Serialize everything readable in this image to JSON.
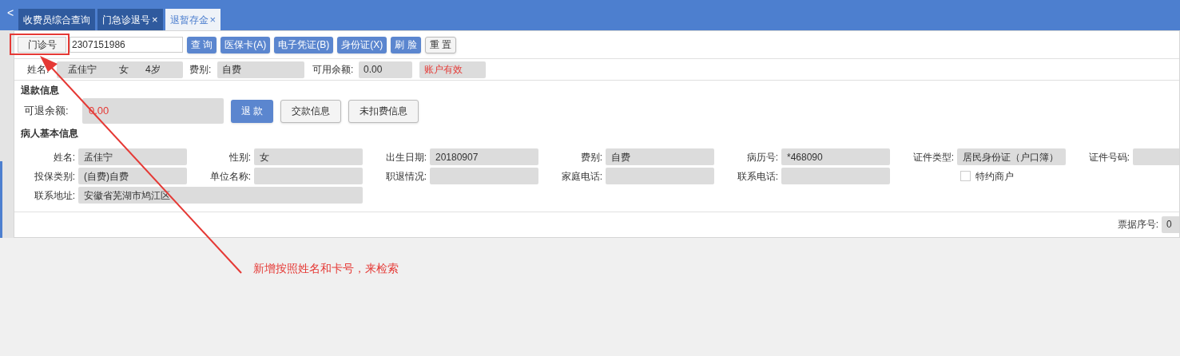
{
  "nav_back": "<",
  "tabs": [
    {
      "label": "收费员综合查询",
      "selected": false,
      "closable": false
    },
    {
      "label": "门急诊退号",
      "selected": false,
      "closable": true
    },
    {
      "label": "退暂存金",
      "selected": true,
      "closable": true
    }
  ],
  "close_glyph": "×",
  "search": {
    "type_button": "门诊号",
    "value": "2307151986",
    "buttons": [
      "查 询",
      "医保卡(A)",
      "电子凭证(B)",
      "身份证(X)",
      "刷 脸"
    ],
    "reset": "重 置"
  },
  "summary": {
    "name_label": "姓名:",
    "name": "孟佳宁",
    "sex": "女",
    "age": "4岁",
    "fee_label": "费别:",
    "fee": "自费",
    "balance_label": "可用余额:",
    "balance": "0.00",
    "account_status": "账户有效"
  },
  "refund": {
    "title": "退款信息",
    "label": "可退余额:",
    "amount": "0.00",
    "buttons": [
      {
        "label": "退 款",
        "kind": "primary"
      },
      {
        "label": "交款信息",
        "kind": "plain"
      },
      {
        "label": "未扣费信息",
        "kind": "plain"
      }
    ]
  },
  "patient": {
    "title": "病人基本信息",
    "fields": [
      {
        "label": "姓名:",
        "value": "孟佳宁",
        "kind": "field"
      },
      {
        "label": "性别:",
        "value": "女",
        "kind": "field"
      },
      {
        "label": "出生日期:",
        "value": "20180907",
        "kind": "field"
      },
      {
        "label": "费别:",
        "value": "自费",
        "kind": "field"
      },
      {
        "label": "病历号:",
        "value": "*468090",
        "kind": "field"
      },
      {
        "label": "证件类型:",
        "value": "居民身份证（户口簿）",
        "kind": "field"
      },
      {
        "label": "证件号码:",
        "kind": "field"
      },
      {
        "label": "投保类别:",
        "value": "(自费)自费",
        "kind": "field"
      },
      {
        "label": "单位名称:",
        "kind": "field"
      },
      {
        "label": "职退情况:",
        "kind": "field"
      },
      {
        "label": "家庭电话:",
        "kind": "field"
      },
      {
        "label": "联系电话:",
        "kind": "field"
      },
      {
        "label": "特约商户",
        "checked": false,
        "kind": "checkbox"
      },
      {
        "label": "联系地址:",
        "value": "安徽省芜湖市鸠江区",
        "kind": "wide"
      }
    ]
  },
  "receipt": {
    "label": "票据序号:",
    "value": "0"
  },
  "annotation": "新增按照姓名和卡号，来检索"
}
